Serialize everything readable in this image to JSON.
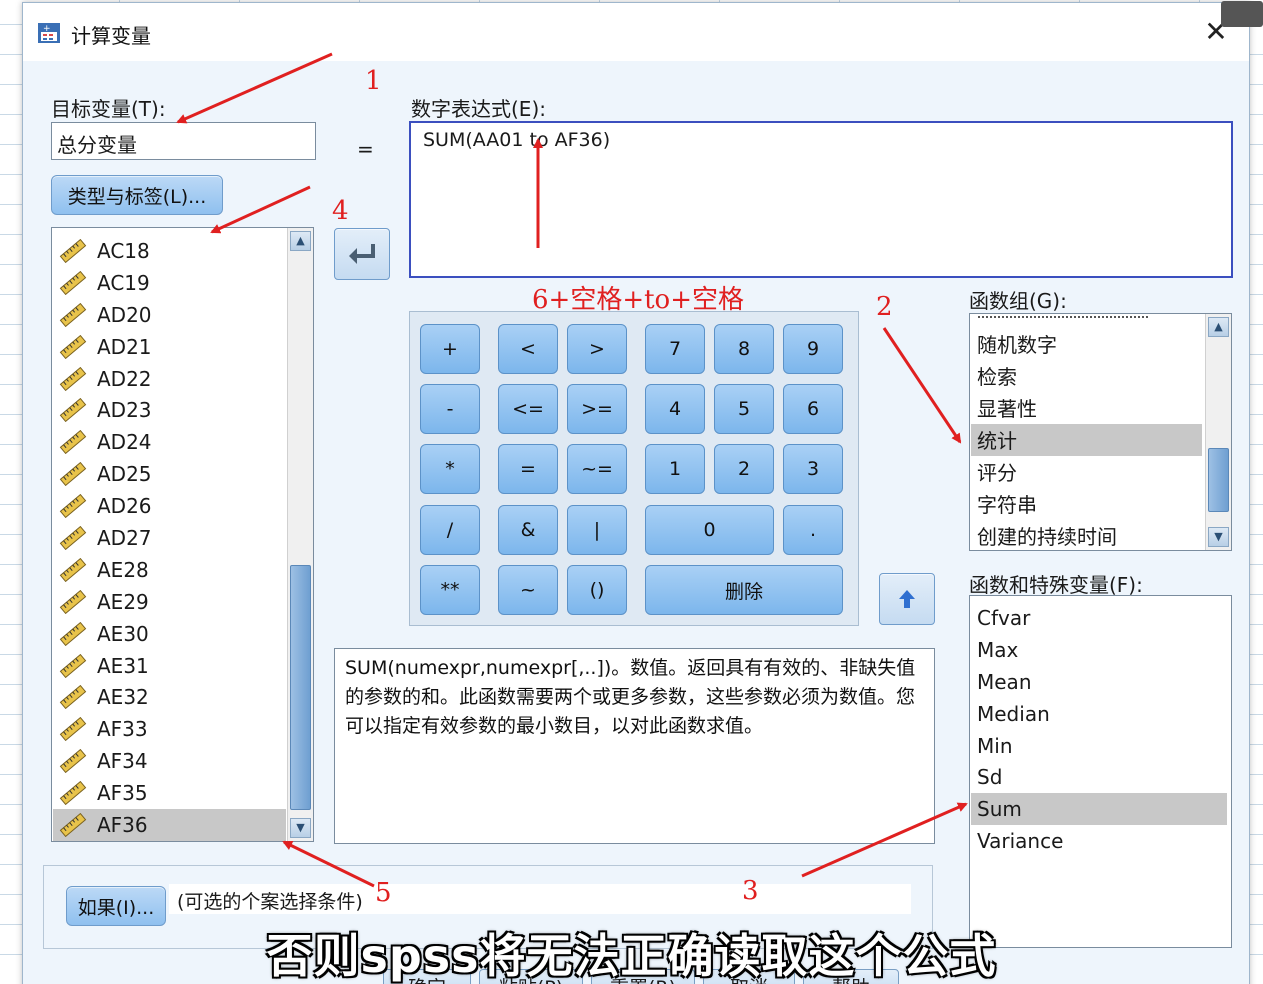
{
  "window": {
    "title": "计算变量",
    "close_glyph": "✕"
  },
  "target": {
    "label": "目标变量(T):",
    "value": "总分变量",
    "type_label_button": "类型与标签(L)..."
  },
  "equals_sign": "=",
  "expression": {
    "label": "数字表达式(E):",
    "value": "SUM(AA01 to AF36)"
  },
  "variables": {
    "items": [
      "AC18",
      "AC19",
      "AD20",
      "AD21",
      "AD22",
      "AD23",
      "AD24",
      "AD25",
      "AD26",
      "AD27",
      "AE28",
      "AE29",
      "AE30",
      "AE31",
      "AE32",
      "AF33",
      "AF34",
      "AF35",
      "AF36"
    ],
    "selected": "AF36",
    "icon": "ruler-icon"
  },
  "keypad": {
    "keys": [
      "+",
      "<",
      ">",
      "7",
      "8",
      "9",
      "-",
      "<=",
      ">=",
      "4",
      "5",
      "6",
      "*",
      "=",
      "~=",
      "1",
      "2",
      "3",
      "/",
      "&",
      "|",
      "0",
      ".",
      "**",
      "~",
      "()",
      "删除"
    ]
  },
  "function_group": {
    "label": "函数组(G):",
    "items": [
      "随机数字",
      "检索",
      "显著性",
      "统计",
      "评分",
      "字符串",
      "创建的持续时间"
    ],
    "selected": "统计"
  },
  "functions": {
    "label": "函数和特殊变量(F):",
    "items": [
      "Cfvar",
      "Max",
      "Mean",
      "Median",
      "Min",
      "Sd",
      "Sum",
      "Variance"
    ],
    "selected": "Sum"
  },
  "description": "SUM(numexpr,numexpr[,..])。数值。返回具有有效的、非缺失值的参数的和。此函数需要两个或更多参数，这些参数必须为数值。您可以指定有效参数的最小数目，以对此函数求值。",
  "if_section": {
    "button": "如果(I)...",
    "text": "(可选的个案选择条件)"
  },
  "bottom_buttons": [
    "确定",
    "粘贴(P)",
    "重置(R)",
    "取消",
    "帮助"
  ],
  "annotations": {
    "n1": "1",
    "n2": "2",
    "n3": "3",
    "n4": "4",
    "n5": "5",
    "tip": "6+空格+to+空格",
    "color": "#e02020"
  },
  "subtitle": "否则spss将无法正确读取这个公式"
}
